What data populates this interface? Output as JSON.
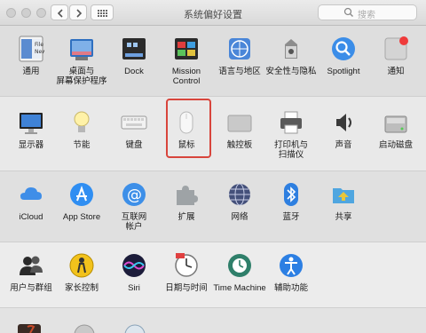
{
  "window": {
    "title": "系统偏好设置"
  },
  "search": {
    "placeholder": "搜索"
  },
  "rows": [
    {
      "items": [
        {
          "name": "general",
          "label": "通用"
        },
        {
          "name": "desktop",
          "label": "桌面与\n屏幕保护程序"
        },
        {
          "name": "dock",
          "label": "Dock"
        },
        {
          "name": "mission-control",
          "label": "Mission\nControl"
        },
        {
          "name": "language",
          "label": "语言与地区"
        },
        {
          "name": "security",
          "label": "安全性与隐私"
        },
        {
          "name": "spotlight",
          "label": "Spotlight"
        },
        {
          "name": "notifications",
          "label": "通知"
        }
      ]
    },
    {
      "items": [
        {
          "name": "displays",
          "label": "显示器"
        },
        {
          "name": "energy",
          "label": "节能"
        },
        {
          "name": "keyboard",
          "label": "键盘"
        },
        {
          "name": "mouse",
          "label": "鼠标"
        },
        {
          "name": "trackpad",
          "label": "触控板"
        },
        {
          "name": "printers",
          "label": "打印机与\n扫描仪"
        },
        {
          "name": "sound",
          "label": "声音"
        },
        {
          "name": "startup-disk",
          "label": "启动磁盘"
        }
      ]
    },
    {
      "items": [
        {
          "name": "icloud",
          "label": "iCloud"
        },
        {
          "name": "app-store",
          "label": "App Store"
        },
        {
          "name": "internet-accounts",
          "label": "互联网\n帐户"
        },
        {
          "name": "extensions",
          "label": "扩展"
        },
        {
          "name": "network",
          "label": "网络"
        },
        {
          "name": "bluetooth",
          "label": "蓝牙"
        },
        {
          "name": "sharing",
          "label": "共享"
        }
      ]
    },
    {
      "items": [
        {
          "name": "users",
          "label": "用户与群组"
        },
        {
          "name": "parental",
          "label": "家长控制"
        },
        {
          "name": "siri",
          "label": "Siri"
        },
        {
          "name": "date-time",
          "label": "日期与时间"
        },
        {
          "name": "time-machine",
          "label": "Time Machine"
        },
        {
          "name": "accessibility",
          "label": "辅助功能"
        }
      ]
    }
  ]
}
